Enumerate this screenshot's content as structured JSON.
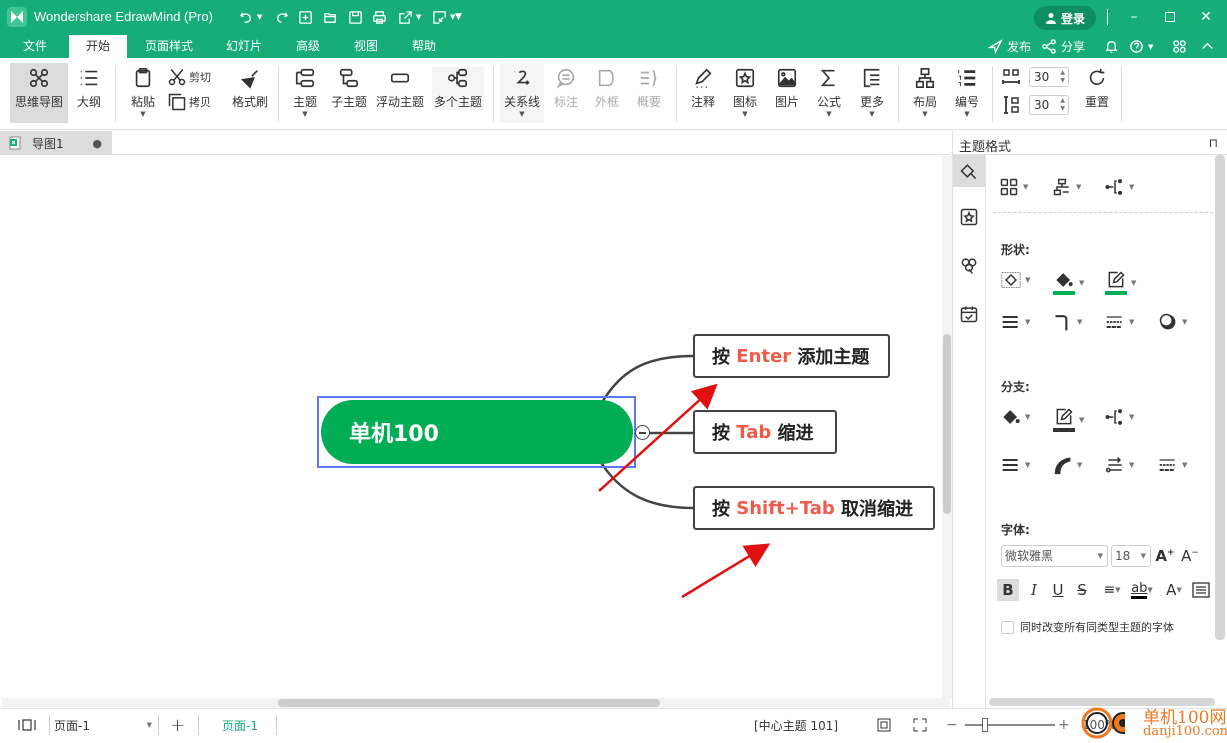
{
  "titlebar": {
    "app_title": "Wondershare EdrawMind (Pro)",
    "quick_access": [
      "undo-icon",
      "redo-icon",
      "new-icon",
      "open-icon",
      "save-icon",
      "print-icon",
      "export-icon",
      "import-icon",
      "customize-icon"
    ],
    "login_label": "登录",
    "window_controls": [
      "minimize",
      "maximize",
      "close"
    ]
  },
  "menubar": {
    "items": [
      "文件",
      "开始",
      "页面样式",
      "幻灯片",
      "高级",
      "视图",
      "帮助"
    ],
    "active": "开始",
    "right": {
      "publish": "发布",
      "share": "分享"
    }
  },
  "ribbon": {
    "mindmap": "思维导图",
    "outline": "大纲",
    "paste": "粘贴",
    "cut": "剪切",
    "copy": "拷贝",
    "format_painter": "格式刷",
    "topic": "主题",
    "subtopic": "子主题",
    "floating_topic": "浮动主题",
    "multiple_topics": "多个主题",
    "relationship": "关系线",
    "callout": "标注",
    "boundary": "外框",
    "summary": "概要",
    "note": "注释",
    "icon": "图标",
    "picture": "图片",
    "formula": "公式",
    "more": "更多",
    "layout": "布局",
    "numbering": "编号",
    "h_spacing": "30",
    "v_spacing": "30",
    "reset": "重置"
  },
  "document": {
    "tab_title": "导图1",
    "unsaved_indicator": "●"
  },
  "mindmap": {
    "central_topic": "单机100",
    "topics": [
      {
        "prefix": "按 ",
        "key": "Enter",
        "suffix": " 添加主题"
      },
      {
        "prefix": "按 ",
        "key": "Tab",
        "suffix": " 缩进"
      },
      {
        "prefix": "按 ",
        "key": "Shift+Tab",
        "suffix": " 取消缩进"
      }
    ],
    "colors": {
      "central_fill": "#00ad55",
      "selection": "#5b78f5",
      "key_text": "#ef5b4b",
      "arrow": "#e01010"
    }
  },
  "panel": {
    "title": "主题格式",
    "shape_label": "形状:",
    "branch_label": "分支:",
    "font_label": "字体:",
    "font_family": "微软雅黑",
    "font_size": "18",
    "apply_all_label": "同时改变所有同类型主题的字体",
    "apply_all_checked": false,
    "accent_color": "#00ad55"
  },
  "statusbar": {
    "page_select": "页面-1",
    "active_page": "页面-1",
    "status_text": "[中心主题 101]",
    "zoom": "100%",
    "zoom_fraction": 0.2
  },
  "watermark": {
    "text1": "单机100网",
    "text2": "danji100.com"
  }
}
